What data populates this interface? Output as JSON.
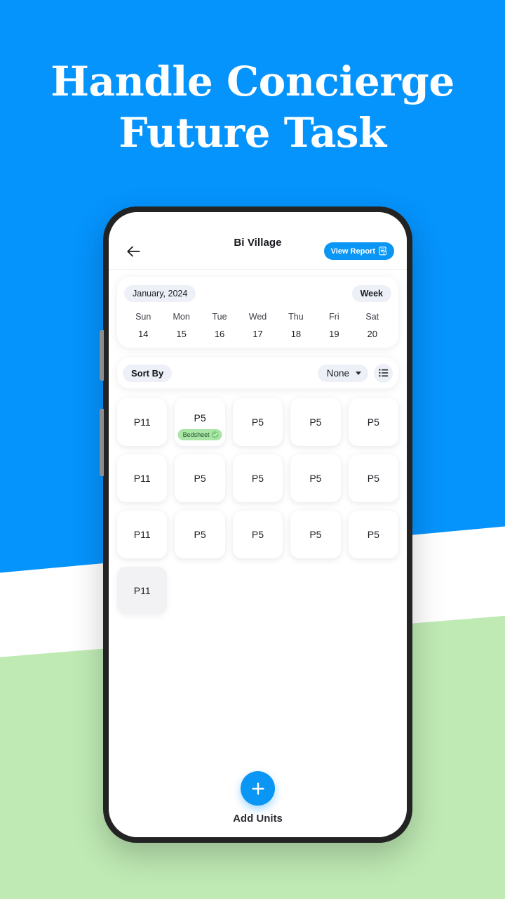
{
  "promo": {
    "headline_line1": "Handle Concierge",
    "headline_line2": "Future Task",
    "background_blue": "#0593fc",
    "background_white": "#ffffff",
    "background_green": "#bfeab4"
  },
  "header": {
    "back_icon": "arrow-left-icon",
    "title": "Bi Village",
    "view_report_label": "View Report",
    "view_report_icon": "report-document-icon",
    "accent": "#0a96f5"
  },
  "calendar": {
    "month_label": "January, 2024",
    "range_label": "Week",
    "day_names": [
      "Sun",
      "Mon",
      "Tue",
      "Wed",
      "Thu",
      "Fri",
      "Sat"
    ],
    "day_numbers": [
      "14",
      "15",
      "16",
      "17",
      "18",
      "19",
      "20"
    ]
  },
  "sort": {
    "label": "Sort By",
    "selected": "None",
    "options": [
      "None"
    ],
    "caret_icon": "chevron-down-icon",
    "list_view_icon": "list-view-icon"
  },
  "units": {
    "rows": [
      [
        {
          "label": "P11",
          "badge": null,
          "muted": false
        },
        {
          "label": "P5",
          "badge": "Bedsheet",
          "badge_icon": "check-circle-icon",
          "muted": false
        },
        {
          "label": "P5",
          "badge": null,
          "muted": false
        },
        {
          "label": "P5",
          "badge": null,
          "muted": false
        },
        {
          "label": "P5",
          "badge": null,
          "muted": false
        }
      ],
      [
        {
          "label": "P11",
          "badge": null,
          "muted": false
        },
        {
          "label": "P5",
          "badge": null,
          "muted": false
        },
        {
          "label": "P5",
          "badge": null,
          "muted": false
        },
        {
          "label": "P5",
          "badge": null,
          "muted": false
        },
        {
          "label": "P5",
          "badge": null,
          "muted": false
        }
      ],
      [
        {
          "label": "P11",
          "badge": null,
          "muted": false
        },
        {
          "label": "P5",
          "badge": null,
          "muted": false
        },
        {
          "label": "P5",
          "badge": null,
          "muted": false
        },
        {
          "label": "P5",
          "badge": null,
          "muted": false
        },
        {
          "label": "P5",
          "badge": null,
          "muted": false
        }
      ],
      [
        {
          "label": "P11",
          "badge": null,
          "muted": true
        }
      ]
    ],
    "badge_color": "#a9e6a6"
  },
  "fab": {
    "icon": "plus-icon",
    "label": "Add Units"
  }
}
